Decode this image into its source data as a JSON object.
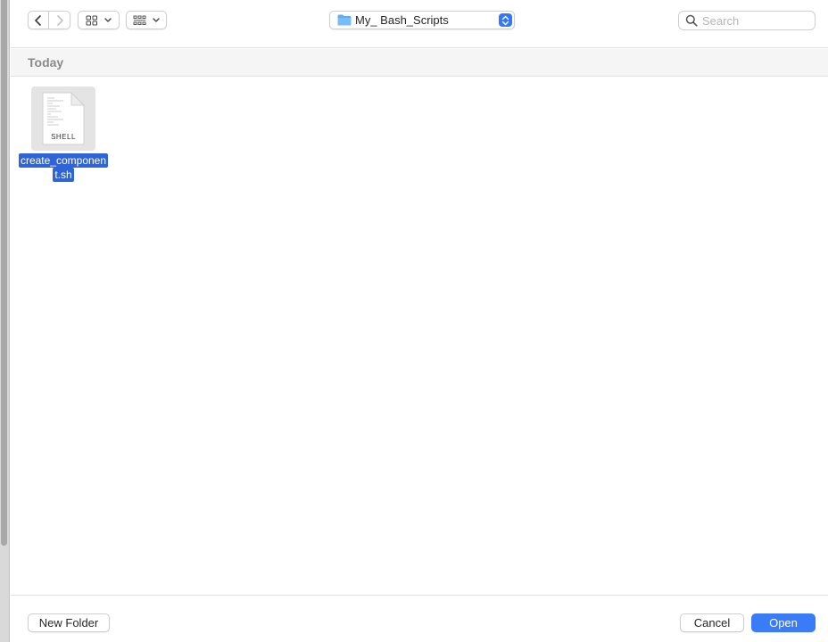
{
  "toolbar": {
    "back_icon": "chevron-left-icon",
    "forward_icon": "chevron-right-icon",
    "view_icon_grid": "icon-view-grid-icon",
    "view_icon_group": "group-view-icon",
    "location": {
      "folder_icon": "folder-icon",
      "label": "My_ Bash_Scripts",
      "stepper_icon": "stepper-updown-icon"
    },
    "search": {
      "icon": "search-icon",
      "placeholder": "Search",
      "value": ""
    }
  },
  "section": {
    "title": "Today"
  },
  "files": [
    {
      "name": "create_component.sh",
      "name_line1": "create_componen",
      "name_line2": "t.sh",
      "type_badge": "SHELL",
      "selected": true
    }
  ],
  "footer": {
    "new_folder_label": "New Folder",
    "cancel_label": "Cancel",
    "open_label": "Open"
  },
  "colors": {
    "accent": "#3a7bf7",
    "selection": "#2f64d6",
    "section_title": "#8a8a8a"
  }
}
